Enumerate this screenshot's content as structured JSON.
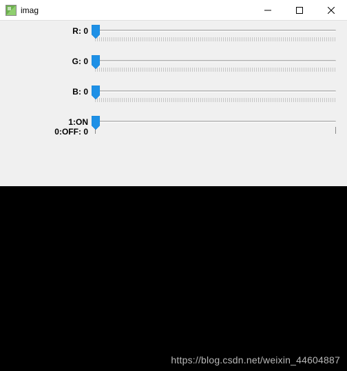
{
  "window": {
    "title": "imag"
  },
  "sliders": {
    "r": {
      "label": "R",
      "value": 0
    },
    "g": {
      "label": "G",
      "value": 0
    },
    "b": {
      "label": "B",
      "value": 0
    },
    "toggle": {
      "label_line1": "1:ON",
      "label_line2": "0:OFF",
      "value": 0
    }
  },
  "watermark": "https://blog.csdn.net/weixin_44604887"
}
